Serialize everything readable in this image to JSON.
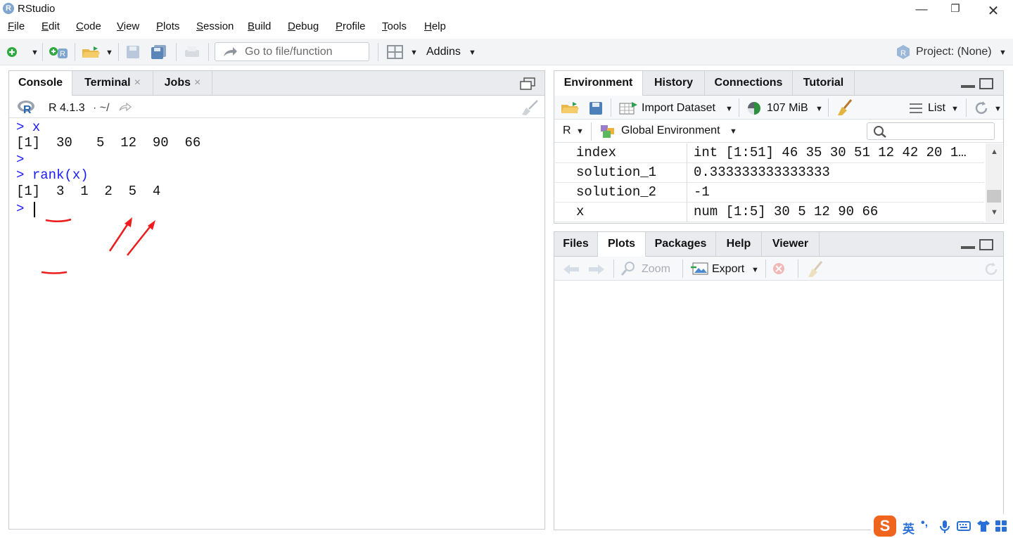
{
  "app": {
    "title": "RStudio"
  },
  "menu": [
    "File",
    "Edit",
    "Code",
    "View",
    "Plots",
    "Session",
    "Build",
    "Debug",
    "Profile",
    "Tools",
    "Help"
  ],
  "toolbar": {
    "goto_placeholder": "Go to file/function",
    "addins": "Addins",
    "project": "Project: (None)"
  },
  "left_pane": {
    "tabs": [
      "Console",
      "Terminal",
      "Jobs"
    ],
    "tab_close": "×",
    "r_version": "R 4.1.3",
    "path": "·  ~/",
    "console_lines": [
      {
        "prompt": ">",
        "cmd": "x"
      },
      {
        "out": "[1]  30   5  12  90  66"
      },
      {
        "prompt": ">",
        "cmd": ""
      },
      {
        "prompt": ">",
        "cmd": "rank(x)"
      },
      {
        "out": "[1]  3  1  2  5  4"
      },
      {
        "prompt": ">",
        "cmd": ""
      }
    ]
  },
  "env_pane": {
    "tabs": [
      "Environment",
      "History",
      "Connections",
      "Tutorial"
    ],
    "import_dataset": "Import Dataset",
    "memory": "107 MiB",
    "view_mode": "List",
    "language": "R",
    "scope": "Global Environment",
    "rows": [
      {
        "name": "index",
        "value": "int [1:51] 46 35 30 51 12 42 20 1…"
      },
      {
        "name": "solution_1",
        "value": "0.333333333333333"
      },
      {
        "name": "solution_2",
        "value": "-1"
      },
      {
        "name": "x",
        "value": "num [1:5] 30 5 12 90 66"
      }
    ]
  },
  "files_pane": {
    "tabs": [
      "Files",
      "Plots",
      "Packages",
      "Help",
      "Viewer"
    ],
    "zoom": "Zoom",
    "export": "Export"
  },
  "ime": {
    "label": "英"
  }
}
